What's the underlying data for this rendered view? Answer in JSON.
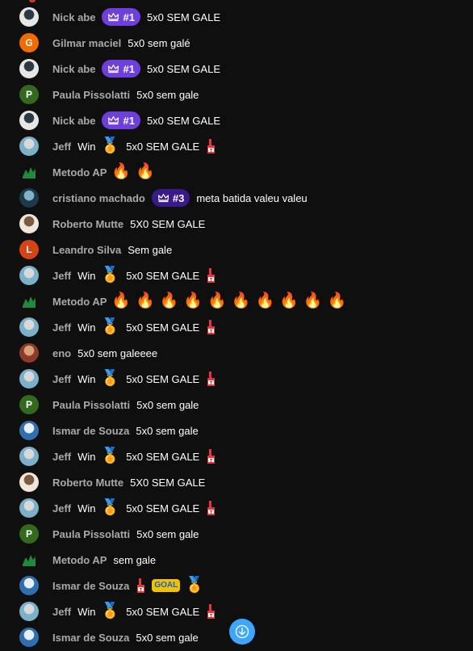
{
  "chat": {
    "messages": [
      {
        "author": "Nick abe",
        "avatar_type": "photo",
        "avatar_colors": [
          "#e6e6e6",
          "#2b3a45"
        ],
        "badge": "#1",
        "badge_color": "#6f3fdb",
        "text": "5x0 SEM GALE",
        "extras": []
      },
      {
        "author": "Gilmar maciel",
        "avatar_type": "letter",
        "avatar_letter": "G",
        "avatar_colors": [
          "#ef6c00",
          "#ef6c00"
        ],
        "badge": null,
        "text": "5x0 sem galé",
        "extras": []
      },
      {
        "author": "Nick abe",
        "avatar_type": "photo",
        "avatar_colors": [
          "#e6e6e6",
          "#2b3a45"
        ],
        "badge": "#1",
        "badge_color": "#6f3fdb",
        "text": "5x0 SEM GALE",
        "extras": []
      },
      {
        "author": "Paula Pissolatti",
        "avatar_type": "letter",
        "avatar_letter": "P",
        "avatar_colors": [
          "#33691e",
          "#33691e"
        ],
        "badge": null,
        "text": "5x0 sem gale",
        "extras": []
      },
      {
        "author": "Nick abe",
        "avatar_type": "photo",
        "avatar_colors": [
          "#e6e6e6",
          "#2b3a45"
        ],
        "badge": "#1",
        "badge_color": "#6f3fdb",
        "text": "5x0 SEM GALE",
        "extras": []
      },
      {
        "author": "Jeff",
        "avatar_type": "photo",
        "avatar_colors": [
          "#7ab0c8",
          "#d8d8d8"
        ],
        "badge": null,
        "text": "Win",
        "after": "5x0 SEM GALE",
        "extras": [
          "medal"
        ],
        "trailing": [
          "foam"
        ]
      },
      {
        "author": "Metodo AP",
        "avatar_type": "logo",
        "avatar_colors": [
          "#0f0f0f",
          "#1f8a3c"
        ],
        "badge": null,
        "text": "",
        "extras": [
          "flame",
          "flame"
        ]
      },
      {
        "author": "cristiano machado",
        "avatar_type": "photo",
        "avatar_colors": [
          "#1d3a4a",
          "#7fb3c9"
        ],
        "badge": "#3",
        "badge_color": "#3a1a8a",
        "text": "meta batida valeu valeu",
        "extras": []
      },
      {
        "author": "Roberto Mutte",
        "avatar_type": "photo",
        "avatar_colors": [
          "#f0e6dc",
          "#7a5a40"
        ],
        "badge": null,
        "text": "5X0 SEM GALE",
        "extras": []
      },
      {
        "author": "Leandro Silva",
        "avatar_type": "letter",
        "avatar_letter": "L",
        "avatar_colors": [
          "#d84315",
          "#d84315"
        ],
        "badge": null,
        "text": "Sem gale",
        "extras": []
      },
      {
        "author": "Jeff",
        "avatar_type": "photo",
        "avatar_colors": [
          "#7ab0c8",
          "#d8d8d8"
        ],
        "badge": null,
        "text": "Win",
        "after": "5x0 SEM GALE",
        "extras": [
          "medal"
        ],
        "trailing": [
          "foam"
        ]
      },
      {
        "author": "Metodo AP",
        "avatar_type": "logo",
        "avatar_colors": [
          "#0f0f0f",
          "#1f8a3c"
        ],
        "badge": null,
        "text": "",
        "extras": [
          "flame",
          "flame",
          "flame",
          "flame",
          "flame",
          "flame",
          "flame",
          "flame",
          "flame",
          "flame"
        ]
      },
      {
        "author": "Jeff",
        "avatar_type": "photo",
        "avatar_colors": [
          "#7ab0c8",
          "#d8d8d8"
        ],
        "badge": null,
        "text": "Win",
        "after": "5x0 SEM GALE",
        "extras": [
          "medal"
        ],
        "trailing": [
          "foam"
        ]
      },
      {
        "author": "eno",
        "avatar_type": "photo",
        "avatar_colors": [
          "#8a3b2a",
          "#d9a07a"
        ],
        "badge": null,
        "text": "5x0 sem galeeee",
        "extras": []
      },
      {
        "author": "Jeff",
        "avatar_type": "photo",
        "avatar_colors": [
          "#7ab0c8",
          "#d8d8d8"
        ],
        "badge": null,
        "text": "Win",
        "after": "5x0 SEM GALE",
        "extras": [
          "medal"
        ],
        "trailing": [
          "foam"
        ]
      },
      {
        "author": "Paula Pissolatti",
        "avatar_type": "letter",
        "avatar_letter": "P",
        "avatar_colors": [
          "#33691e",
          "#33691e"
        ],
        "badge": null,
        "text": "5x0 sem gale",
        "extras": []
      },
      {
        "author": "Ismar de Souza",
        "avatar_type": "photo",
        "avatar_colors": [
          "#2f6fb0",
          "#e8eef5"
        ],
        "badge": null,
        "text": "5x0 sem gale",
        "extras": []
      },
      {
        "author": "Jeff",
        "avatar_type": "photo",
        "avatar_colors": [
          "#7ab0c8",
          "#d8d8d8"
        ],
        "badge": null,
        "text": "Win",
        "after": "5x0 SEM GALE",
        "extras": [
          "medal"
        ],
        "trailing": [
          "foam"
        ]
      },
      {
        "author": "Roberto Mutte",
        "avatar_type": "photo",
        "avatar_colors": [
          "#f0e6dc",
          "#7a5a40"
        ],
        "badge": null,
        "text": "5X0 SEM GALE",
        "extras": []
      },
      {
        "author": "Jeff",
        "avatar_type": "photo",
        "avatar_colors": [
          "#7ab0c8",
          "#d8d8d8"
        ],
        "badge": null,
        "text": "Win",
        "after": "5x0 SEM GALE",
        "extras": [
          "medal"
        ],
        "trailing": [
          "foam"
        ]
      },
      {
        "author": "Paula Pissolatti",
        "avatar_type": "letter",
        "avatar_letter": "P",
        "avatar_colors": [
          "#33691e",
          "#33691e"
        ],
        "badge": null,
        "text": "5x0 sem gale",
        "extras": []
      },
      {
        "author": "Metodo AP",
        "avatar_type": "logo",
        "avatar_colors": [
          "#0f0f0f",
          "#1f8a3c"
        ],
        "badge": null,
        "text": "sem gale",
        "extras": []
      },
      {
        "author": "Ismar de Souza",
        "avatar_type": "photo",
        "avatar_colors": [
          "#2f6fb0",
          "#e8eef5"
        ],
        "badge": null,
        "text": "",
        "extras": [
          "foam",
          "goal",
          "medal"
        ]
      },
      {
        "author": "Jeff",
        "avatar_type": "photo",
        "avatar_colors": [
          "#7ab0c8",
          "#d8d8d8"
        ],
        "badge": null,
        "text": "Win",
        "after": "5x0 SEM GALE",
        "extras": [
          "medal"
        ],
        "trailing": [
          "foam"
        ]
      },
      {
        "author": "Ismar de Souza",
        "avatar_type": "photo",
        "avatar_colors": [
          "#2f6fb0",
          "#e8eef5"
        ],
        "badge": null,
        "text": "5x0 sem gale",
        "extras": []
      }
    ]
  },
  "emoji_labels": {
    "goal": "GOAL"
  },
  "scroll_button": {
    "icon": "arrow-down-icon",
    "color": "#3ea6ff"
  }
}
